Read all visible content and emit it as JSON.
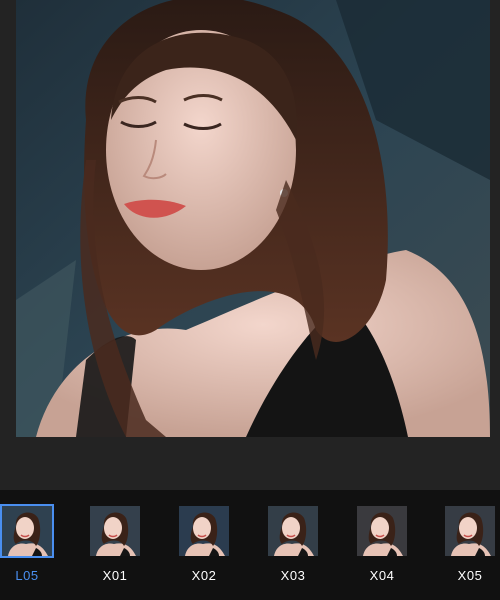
{
  "editor": {
    "photo_subject": "selfie-portrait"
  },
  "filters": {
    "selected_index": 0,
    "accent_color": "#4a8ff0",
    "label_color": "#ffffff",
    "items": [
      {
        "label": "L05",
        "tone": "#2f4150"
      },
      {
        "label": "X01",
        "tone": "#34404c"
      },
      {
        "label": "X02",
        "tone": "#2b3c4f"
      },
      {
        "label": "X03",
        "tone": "#333e48"
      },
      {
        "label": "X04",
        "tone": "#3a3a3e"
      },
      {
        "label": "X05",
        "tone": "#363c44"
      }
    ]
  }
}
